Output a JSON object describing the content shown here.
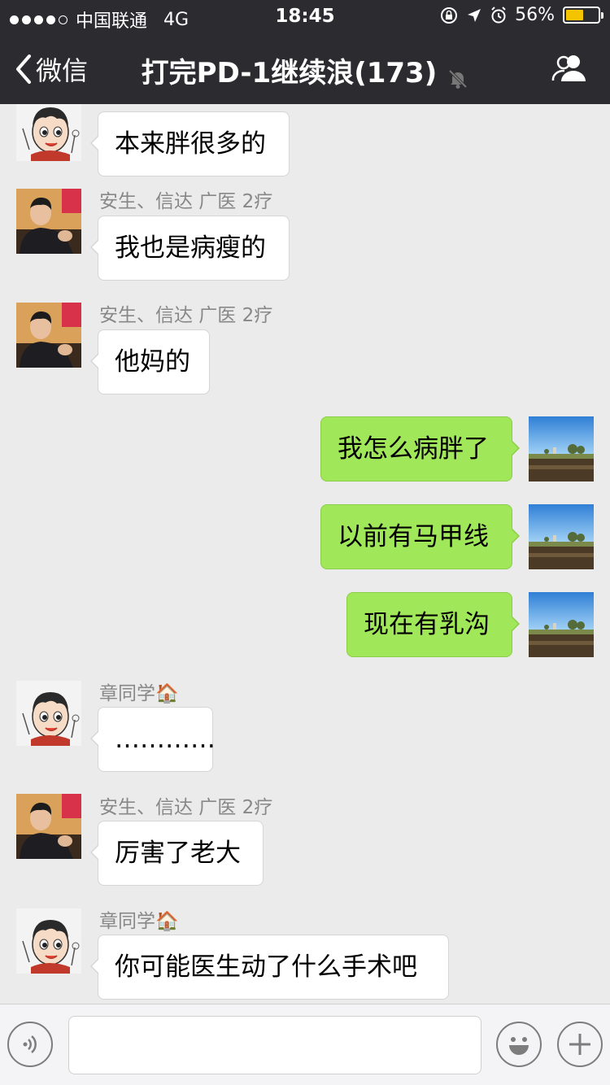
{
  "status_bar": {
    "carrier": "中国联通",
    "network": "4G",
    "time": "18:45",
    "battery": "56%",
    "battery_level": 0.56
  },
  "nav": {
    "back_label": "微信",
    "title": "打完PD-1继续浪(173)"
  },
  "messages": [
    {
      "side": "in",
      "sender": "",
      "text": "本来胖很多的",
      "avatar": "cartoon-boy"
    },
    {
      "side": "in",
      "sender": "安生、信达 广医 2疗",
      "text": "我也是病瘦的",
      "avatar": "man-photo"
    },
    {
      "side": "in",
      "sender": "安生、信达 广医 2疗",
      "text": "他妈的",
      "avatar": "man-photo"
    },
    {
      "side": "out",
      "sender": "",
      "text": "我怎么病胖了",
      "avatar": "landscape-photo"
    },
    {
      "side": "out",
      "sender": "",
      "text": "以前有马甲线",
      "avatar": "landscape-photo"
    },
    {
      "side": "out",
      "sender": "",
      "text": "现在有乳沟",
      "avatar": "landscape-photo"
    },
    {
      "side": "in",
      "sender": "章同学🏠",
      "text": "…………",
      "avatar": "cartoon-boy"
    },
    {
      "side": "in",
      "sender": "安生、信达 广医 2疗",
      "text": "厉害了老大",
      "avatar": "man-photo"
    },
    {
      "side": "in",
      "sender": "章同学🏠",
      "text": "你可能医生动了什么手术吧",
      "avatar": "cartoon-boy"
    }
  ],
  "input_bar": {
    "voice_icon": "voice-icon",
    "emoji_icon": "emoji-icon",
    "plus_icon": "plus-icon",
    "text_value": ""
  },
  "colors": {
    "nav_bg": "#2b2b30",
    "chat_bg": "#ebebeb",
    "outgoing_bubble": "#a0e75a",
    "incoming_bubble": "#ffffff",
    "battery": "#f5c400"
  }
}
